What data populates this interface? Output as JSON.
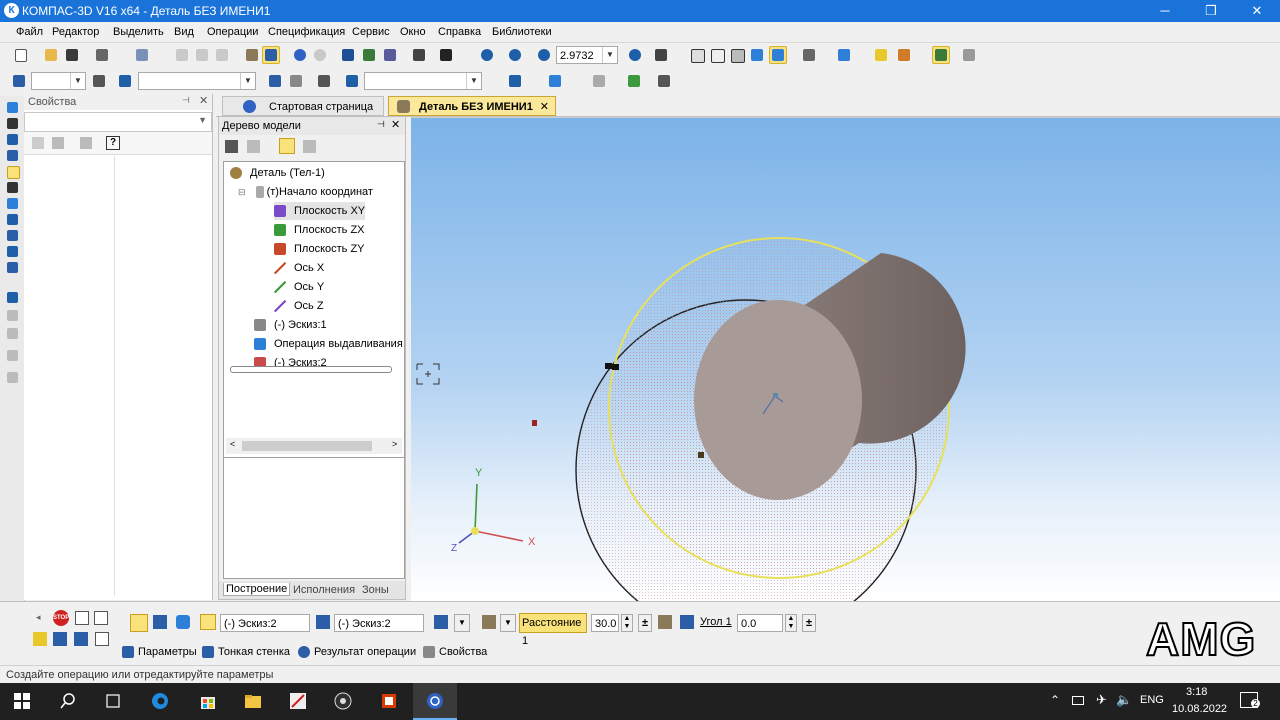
{
  "window": {
    "title": "КОМПАС-3D V16  x64 - Деталь БЕЗ ИМЕНИ1",
    "min": "─",
    "max": "❐",
    "close": "✕",
    "app_icon": "К"
  },
  "menu": [
    "Файл",
    "Редактор",
    "Выделить",
    "Вид",
    "Операции",
    "Спецификация",
    "Сервис",
    "Окно",
    "Справка",
    "Библиотеки"
  ],
  "toolbar": {
    "zoom_value": "2.9732",
    "combo_empty": ""
  },
  "properties_panel": {
    "title": "Свойства",
    "pin": "📌",
    "close": "✕",
    "help": "?"
  },
  "tabs": {
    "start_page": "Стартовая страница",
    "active_doc": "Деталь БЕЗ ИМЕНИ1",
    "close": "✕"
  },
  "model_tree": {
    "title": "Дерево модели",
    "pin": "📌",
    "close": "✕",
    "items": [
      {
        "label": "Деталь (Тел-1)",
        "icon": "part-icon"
      },
      {
        "label": "(т)Начало координат",
        "icon": "origin-icon"
      },
      {
        "label": "Плоскость XY",
        "icon": "plane-xy-icon"
      },
      {
        "label": "Плоскость ZX",
        "icon": "plane-zx-icon"
      },
      {
        "label": "Плоскость ZY",
        "icon": "plane-zy-icon"
      },
      {
        "label": "Ось X",
        "icon": "axis-x-icon"
      },
      {
        "label": "Ось Y",
        "icon": "axis-y-icon"
      },
      {
        "label": "Ось Z",
        "icon": "axis-z-icon"
      },
      {
        "label": "(-) Эскиз:1",
        "icon": "sketch-icon"
      },
      {
        "label": "Операция выдавливания",
        "icon": "extrude-icon"
      },
      {
        "label": "(-) Эскиз:2",
        "icon": "sketch-icon"
      }
    ],
    "bottom_tabs": [
      "Построение",
      "Исполнения",
      "Зоны"
    ]
  },
  "viewport": {
    "axis_labels": {
      "x": "X",
      "y": "Y",
      "z": "Z"
    }
  },
  "params_bar": {
    "field_sketch1": "(-) Эскиз:2",
    "field_sketch2": "(-) Эскиз:2",
    "distance_label": "Расстояние 1",
    "distance_value": "30.0",
    "angle_label": "Угол 1",
    "angle_value": "0.0",
    "tabs": [
      "Параметры",
      "Тонкая стенка",
      "Результат операции",
      "Свойства"
    ],
    "stop_label": "STOP"
  },
  "status_bar": {
    "text": "Создайте операцию или отредактируйте параметры"
  },
  "taskbar": {
    "lang": "ENG",
    "time": "3:18",
    "date": "10.08.2022",
    "notifications": "2"
  },
  "watermark": "AMG",
  "colors": {
    "titlebar": "#1a73d9",
    "highlight": "#f9e27a",
    "cylinder": "#a89a96",
    "yellow_circle": "#e8e05a"
  }
}
